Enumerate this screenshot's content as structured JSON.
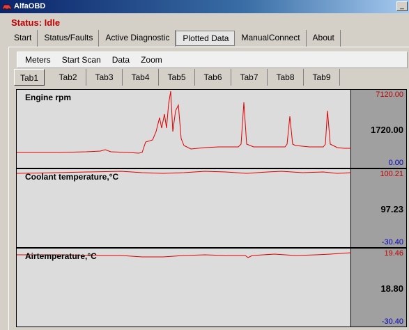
{
  "window": {
    "title": "AlfaOBD",
    "btn_minimize": "_"
  },
  "status": "Status: Idle",
  "main_tabs": [
    "Start",
    "Status/Faults",
    "Active Diagnostic",
    "Plotted Data",
    "ManualConnect",
    "About"
  ],
  "main_tab_active": "Plotted Data",
  "submenu": [
    "Meters",
    "Start Scan",
    "Data",
    "Zoom"
  ],
  "sub_tabs": [
    "Tab1",
    "Tab2",
    "Tab3",
    "Tab4",
    "Tab5",
    "Tab6",
    "Tab7",
    "Tab8",
    "Tab9"
  ],
  "sub_tab_active": "Tab1",
  "plots": [
    {
      "label": "Engine rpm",
      "max": "7120.00",
      "current": "1720.00",
      "min": "0.00"
    },
    {
      "label": "Coolant temperature,°C",
      "max": "100.21",
      "current": "97.23",
      "min": "-30.40"
    },
    {
      "label": "Airtemperature,°C",
      "max": "19.46",
      "current": "18.80",
      "min": "-30.40"
    }
  ],
  "colors": {
    "trace": "#e00000",
    "max": "#c00000",
    "min": "#0000c0"
  }
}
